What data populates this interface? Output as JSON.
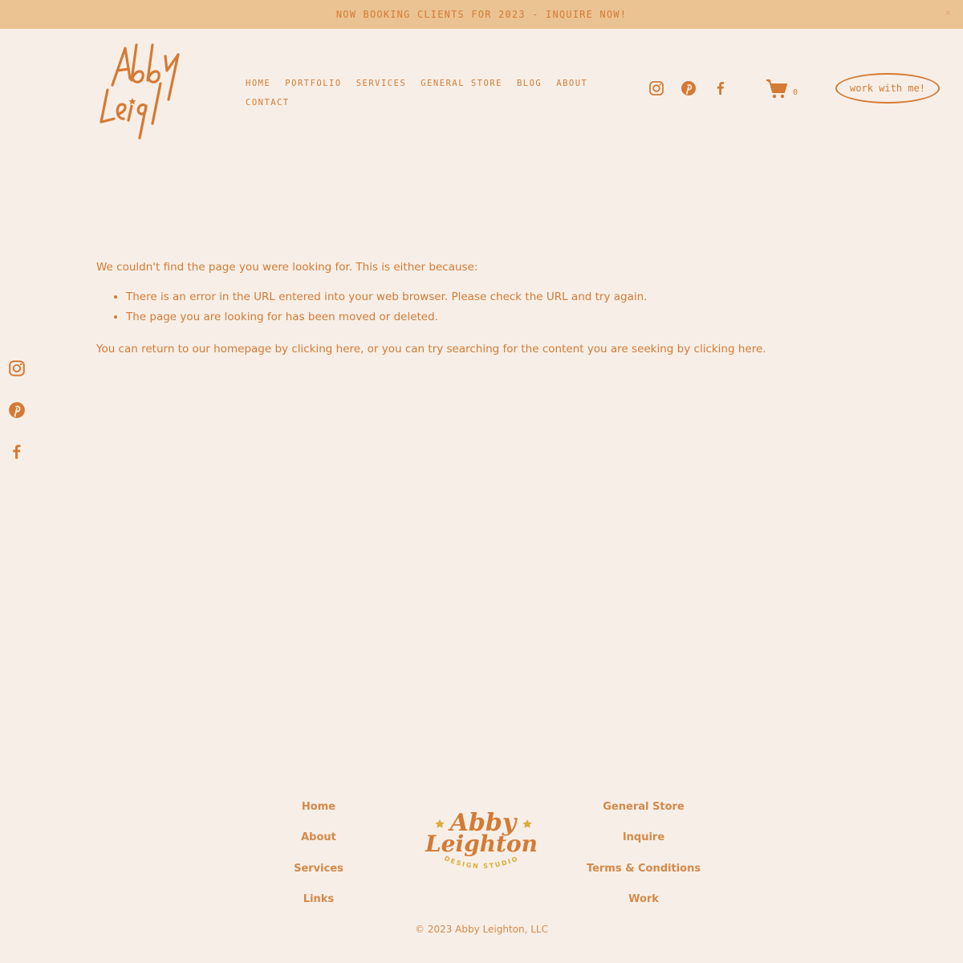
{
  "announcement": {
    "text": "NOW BOOKING CLIENTS FOR 2023 - INQUIRE NOW!",
    "close": "×"
  },
  "brand": {
    "logo_text": "Abby Leighton",
    "footer_logo_line1": "Abby",
    "footer_logo_line2": "Leighton",
    "footer_logo_tagline": "DESIGN STUDIO",
    "accent": "#d47a35",
    "background": "#f7efe7",
    "banner_bg": "#ebc392",
    "footer_star": "#dbac3a"
  },
  "nav": {
    "items": [
      "HOME",
      "PORTFOLIO",
      "SERVICES",
      "GENERAL STORE",
      "BLOG",
      "ABOUT",
      "CONTACT"
    ]
  },
  "header_social": [
    "instagram-icon",
    "pinterest-icon",
    "facebook-icon"
  ],
  "cart": {
    "count": "0",
    "icon": "cart-icon"
  },
  "cta": {
    "label": "work with me!"
  },
  "error": {
    "intro": "We couldn't find the page you were looking for. This is either because:",
    "reasons": [
      "There is an error in the URL entered into your web browser. Please check the URL and try again.",
      "The page you are looking for has been moved or deleted."
    ],
    "return_prefix": "You can return to our homepage by ",
    "return_link": "clicking here",
    "return_middle": ", or you can try searching for the content you are seeking by ",
    "search_link": "clicking here",
    "return_suffix": "."
  },
  "side_social": [
    "instagram-icon",
    "pinterest-icon",
    "facebook-icon"
  ],
  "footer": {
    "left_links": [
      "Home",
      "About",
      "Services",
      "Links"
    ],
    "right_links": [
      "General Store",
      "Inquire",
      "Terms & Conditions",
      "Work"
    ],
    "copyright": "© 2023 Abby Leighton, LLC"
  }
}
